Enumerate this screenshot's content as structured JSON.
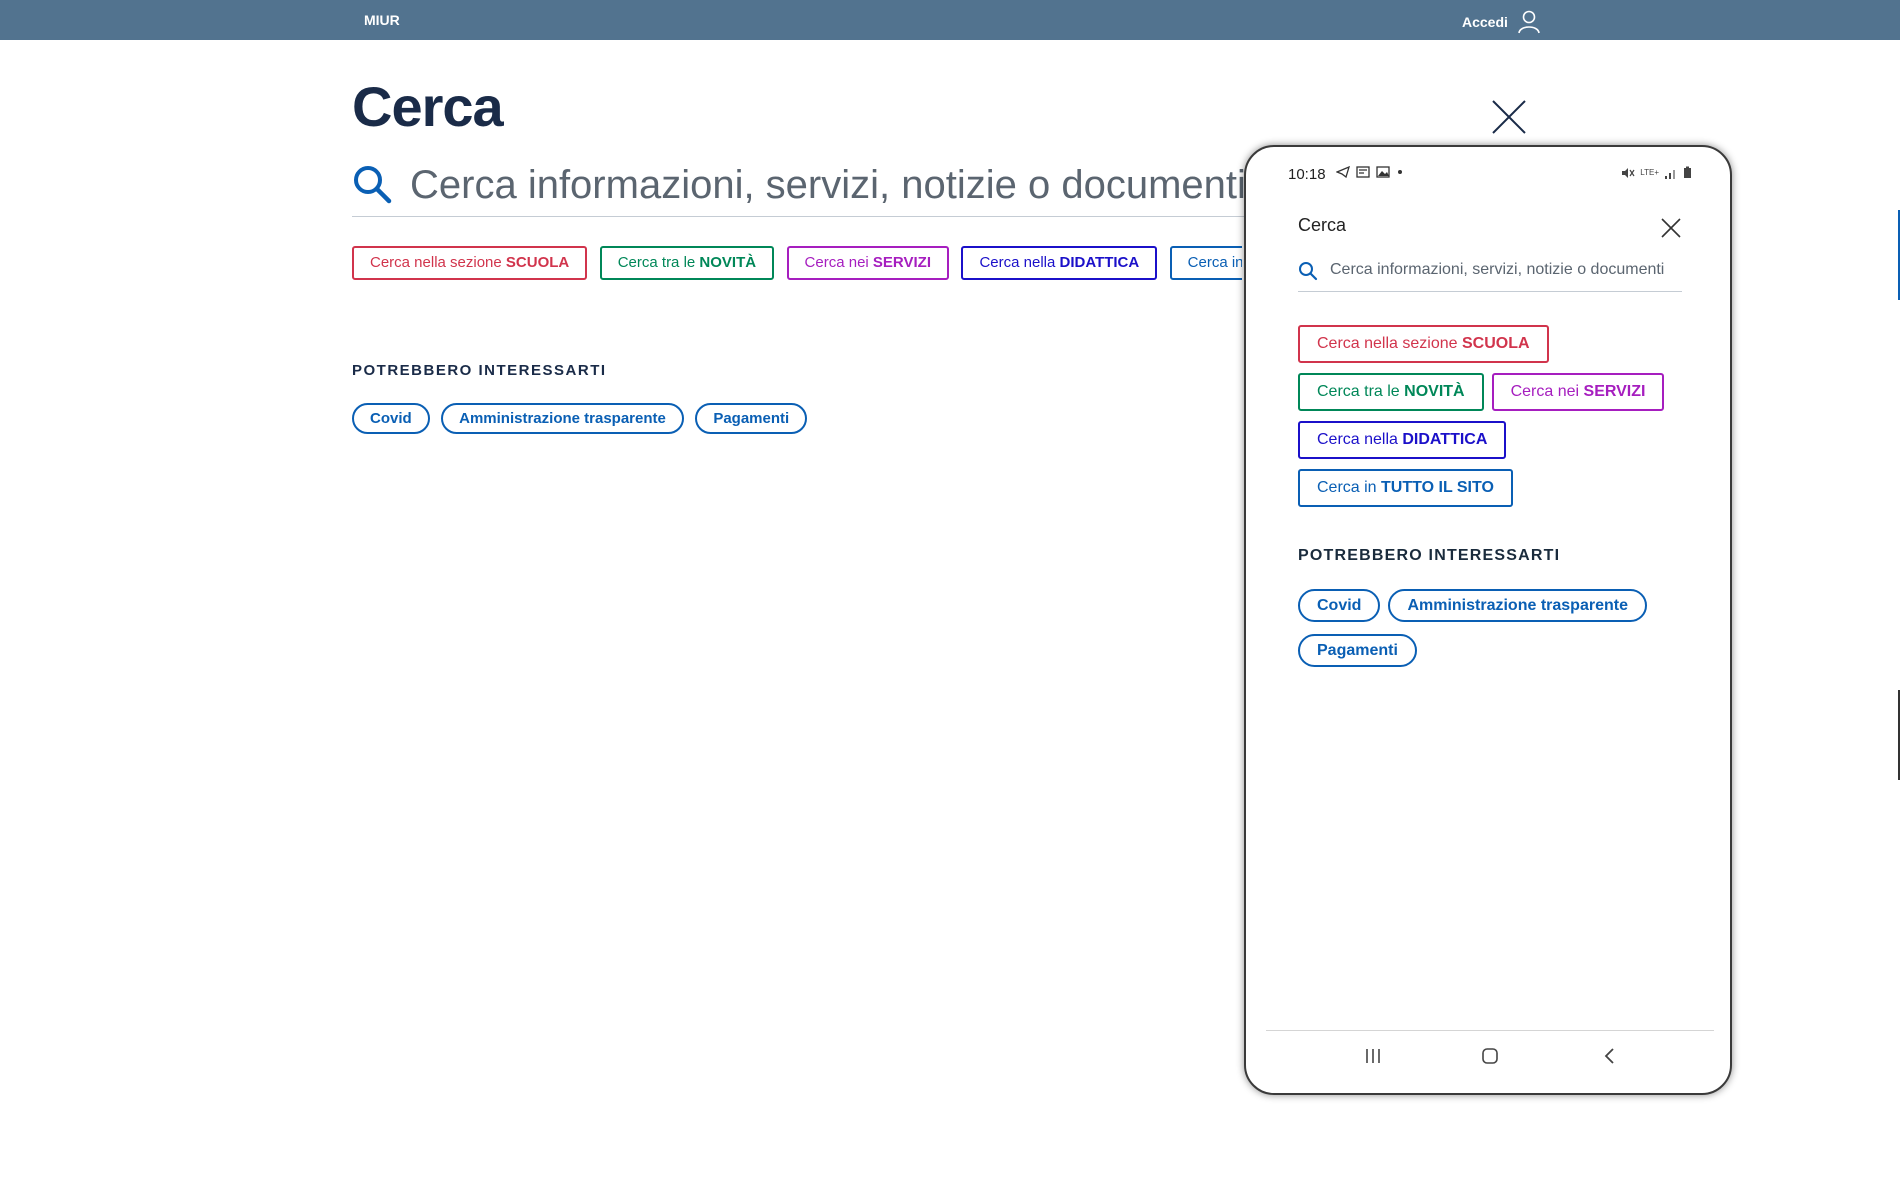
{
  "topbar": {
    "brand": "MIUR",
    "login_label": "Accedi"
  },
  "page": {
    "title": "Cerca",
    "search_placeholder": "Cerca informazioni, servizi, notizie o documenti"
  },
  "filters": [
    {
      "prefix": "Cerca nella sezione ",
      "bold": "SCUOLA",
      "color": "#d1344c"
    },
    {
      "prefix": "Cerca tra le ",
      "bold": "NOVITÀ",
      "color": "#008758"
    },
    {
      "prefix": "Cerca nei ",
      "bold": "SERVIZI",
      "color": "#a61ebf"
    },
    {
      "prefix": "Cerca nella ",
      "bold": "DIDATTICA",
      "color": "#1b10c9"
    },
    {
      "prefix": "Cerca in ",
      "bold": "TUTTO IL SITO",
      "color": "#0a5fb4"
    }
  ],
  "suggestions": {
    "heading": "POTREBBERO INTERESSARTI",
    "items": [
      "Covid",
      "Amministrazione trasparente",
      "Pagamenti"
    ]
  },
  "mobile": {
    "status_time": "10:18",
    "status_network": "LTE+",
    "title": "Cerca",
    "search_placeholder": "Cerca informazioni, servizi, notizie o documenti"
  },
  "icons": {
    "user": "user-icon",
    "close": "close-icon",
    "search": "search-icon",
    "recent_apps": "recent-apps-icon",
    "home": "home-icon",
    "back": "back-icon"
  },
  "colors": {
    "topbar": "#52738f",
    "primary": "#0a5fb4",
    "title": "#1a2b48"
  }
}
